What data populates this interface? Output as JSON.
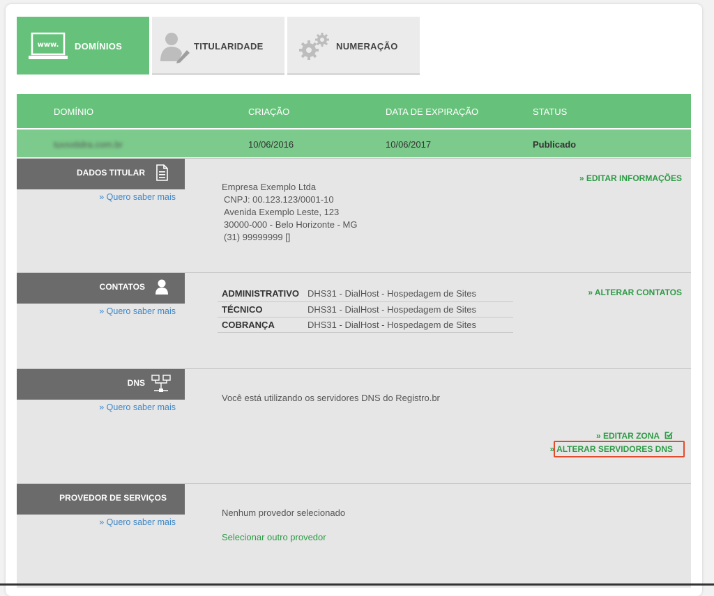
{
  "tabs": [
    {
      "label": "DOMÍNIOS",
      "icon": "www-laptop-icon",
      "active": true
    },
    {
      "label": "TITULARIDADE",
      "icon": "user-pen-icon",
      "active": false
    },
    {
      "label": "NUMERAÇÃO",
      "icon": "gears-icon",
      "active": false
    }
  ],
  "table": {
    "headers": [
      "DOMÍNIO",
      "CRIAÇÃO",
      "DATA DE EXPIRAÇÃO",
      "STATUS"
    ],
    "row": {
      "domain": "tuvxxtidra.com.br",
      "created": "10/06/2016",
      "expires": "10/06/2017",
      "status": "Publicado"
    }
  },
  "sections": {
    "titular": {
      "title": "DADOS TITULAR",
      "more": "» Quero saber mais",
      "lines": [
        "Empresa Exemplo Ltda",
        "CNPJ: 00.123.123/0001-10",
        "Avenida Exemplo Leste, 123",
        "30000-000 - Belo Horizonte - MG",
        "(31) 99999999 []"
      ],
      "action": "» EDITAR INFORMAÇÕES"
    },
    "contatos": {
      "title": "CONTATOS",
      "more": "» Quero saber mais",
      "rows": [
        {
          "role": "ADMINISTRATIVO",
          "value": "DHS31 - DialHost - Hospedagem de Sites"
        },
        {
          "role": "TÉCNICO",
          "value": "DHS31 - DialHost - Hospedagem de Sites"
        },
        {
          "role": "COBRANÇA",
          "value": "DHS31 - DialHost - Hospedagem de Sites"
        }
      ],
      "action": "» ALTERAR CONTATOS"
    },
    "dns": {
      "title": "DNS",
      "more": "» Quero saber mais",
      "text": "Você está utilizando os servidores DNS do Registro.br",
      "edit_zone": "» EDITAR ZONA",
      "change_servers": "» ALTERAR SERVIDORES DNS"
    },
    "provedor": {
      "title": "PROVEDOR DE SERVIÇOS",
      "more": "» Quero saber mais",
      "text": "Nenhum provedor selecionado",
      "link": "Selecionar outro provedor"
    }
  },
  "colors": {
    "accent": "#66c27a",
    "row": "#7ccb8c",
    "label_bg": "#6b6b6b",
    "link": "#3f87c6",
    "action": "#2e9b46",
    "highlight": "#e24b2c"
  }
}
